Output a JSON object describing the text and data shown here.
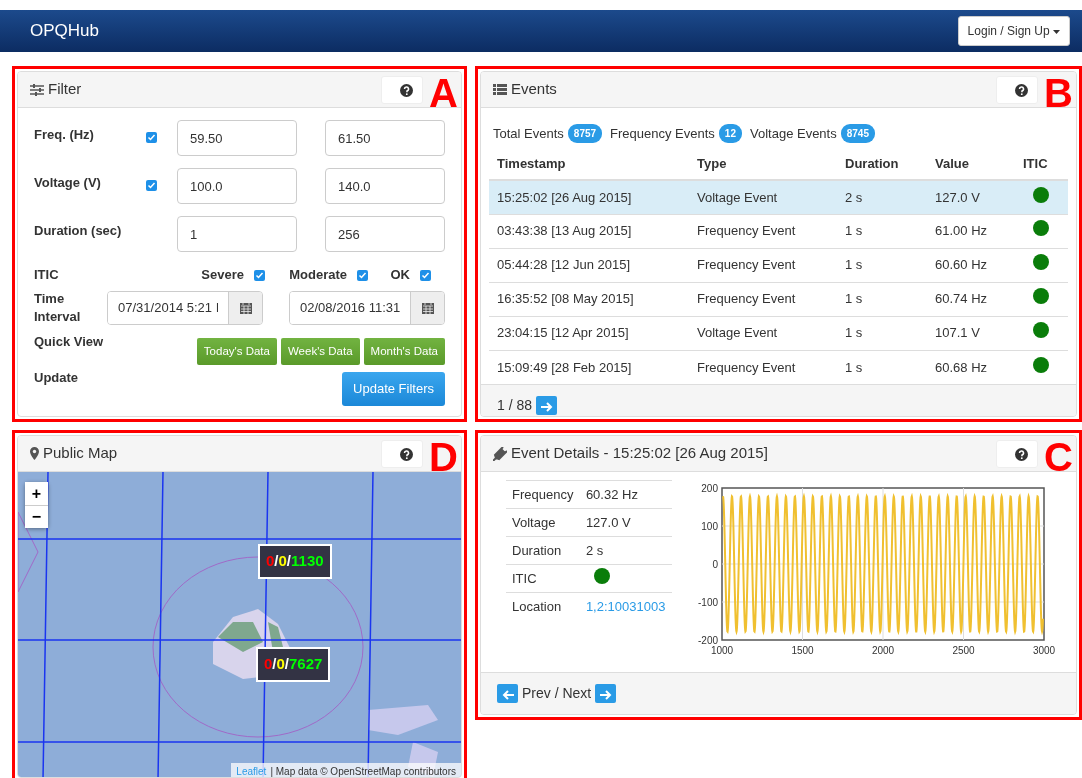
{
  "navbar": {
    "brand": "OPQHub",
    "login_button": "Login / Sign Up"
  },
  "filter": {
    "title": "Filter",
    "annotation": "A",
    "ranges": [
      {
        "kind": "checkbox",
        "label": "Freq. (Hz)",
        "checked": true,
        "min": "59.50",
        "max": "61.50"
      },
      {
        "kind": "checkbox",
        "label": "Voltage (V)",
        "checked": true,
        "min": "100.0",
        "max": "140.0"
      },
      {
        "kind": "plain",
        "label": "Duration (sec)",
        "min": "1",
        "max": "256"
      }
    ],
    "itic": {
      "label": "ITIC",
      "options": [
        {
          "label": "Severe",
          "checked": true
        },
        {
          "label": "Moderate",
          "checked": true
        },
        {
          "label": "OK",
          "checked": true
        }
      ]
    },
    "time_interval": {
      "label": "Time Interval",
      "start": "07/31/2014 5:21 I",
      "end": "02/08/2016 11:31"
    },
    "quick_view": {
      "label": "Quick View",
      "buttons": [
        "Today's Data",
        "Week's Data",
        "Month's Data"
      ]
    },
    "update": {
      "label": "Update",
      "button": "Update Filters"
    }
  },
  "events": {
    "title": "Events",
    "annotation": "B",
    "counts": [
      {
        "label": "Total Events",
        "count": "8757"
      },
      {
        "label": "Frequency Events",
        "count": "12"
      },
      {
        "label": "Voltage Events",
        "count": "8745"
      }
    ],
    "columns": [
      "Timestamp",
      "Type",
      "Duration",
      "Value",
      "ITIC"
    ],
    "rows": [
      {
        "timestamp": "15:25:02 [26 Aug 2015]",
        "type": "Voltage Event",
        "duration": "2 s",
        "value": "127.0 V",
        "color": "#0a7d0a",
        "selected": true
      },
      {
        "timestamp": "03:43:38 [13 Aug 2015]",
        "type": "Frequency Event",
        "duration": "1 s",
        "value": "61.00 Hz",
        "color": "#0a7d0a",
        "selected": false
      },
      {
        "timestamp": "05:44:28 [12 Jun 2015]",
        "type": "Frequency Event",
        "duration": "1 s",
        "value": "60.60 Hz",
        "color": "#0a7d0a",
        "selected": false
      },
      {
        "timestamp": "16:35:52 [08 May 2015]",
        "type": "Frequency Event",
        "duration": "1 s",
        "value": "60.74 Hz",
        "color": "#0a7d0a",
        "selected": false
      },
      {
        "timestamp": "23:04:15 [12 Apr 2015]",
        "type": "Voltage Event",
        "duration": "1 s",
        "value": "107.1 V",
        "color": "#0a7d0a",
        "selected": false
      },
      {
        "timestamp": "15:09:49 [28 Feb 2015]",
        "type": "Frequency Event",
        "duration": "1 s",
        "value": "60.68 Hz",
        "color": "#0a7d0a",
        "selected": false
      }
    ],
    "pager": "1 / 88"
  },
  "map": {
    "title": "Public Map",
    "annotation": "D",
    "zoom_in": "+",
    "zoom_out": "−",
    "markers": [
      {
        "parts": [
          {
            "text": "0",
            "color": "#ff0000"
          },
          {
            "text": "/",
            "color": "#ffffff"
          },
          {
            "text": "0",
            "color": "#ffff00"
          },
          {
            "text": "/",
            "color": "#ffffff"
          },
          {
            "text": "1130",
            "color": "#00ff00"
          }
        ]
      },
      {
        "parts": [
          {
            "text": "0",
            "color": "#ff0000"
          },
          {
            "text": "/",
            "color": "#ffffff"
          },
          {
            "text": "0",
            "color": "#ffff00"
          },
          {
            "text": "/",
            "color": "#ffffff"
          },
          {
            "text": "7627",
            "color": "#00ff00"
          }
        ]
      }
    ],
    "attribution": {
      "link": "Leaflet",
      "text": "| Map data © OpenStreetMap contributors"
    }
  },
  "details": {
    "title": "Event Details - 15:25:02 [26 Aug 2015]",
    "annotation": "C",
    "fields": [
      {
        "kind": "text",
        "label": "Frequency",
        "value": "60.32 Hz"
      },
      {
        "kind": "text",
        "label": "Voltage",
        "value": "127.0 V"
      },
      {
        "kind": "text",
        "label": "Duration",
        "value": "2 s"
      },
      {
        "kind": "dot",
        "label": "ITIC",
        "color": "#0a7d0a"
      },
      {
        "kind": "link",
        "label": "Location",
        "value": "1,2:10031003"
      }
    ],
    "waveform": {
      "y_labels": [
        "200",
        "100",
        "0",
        "-100",
        "-200"
      ],
      "x_labels": [
        "1000",
        "1500",
        "2000",
        "2500",
        "3000"
      ]
    },
    "pager": "Prev / Next"
  }
}
